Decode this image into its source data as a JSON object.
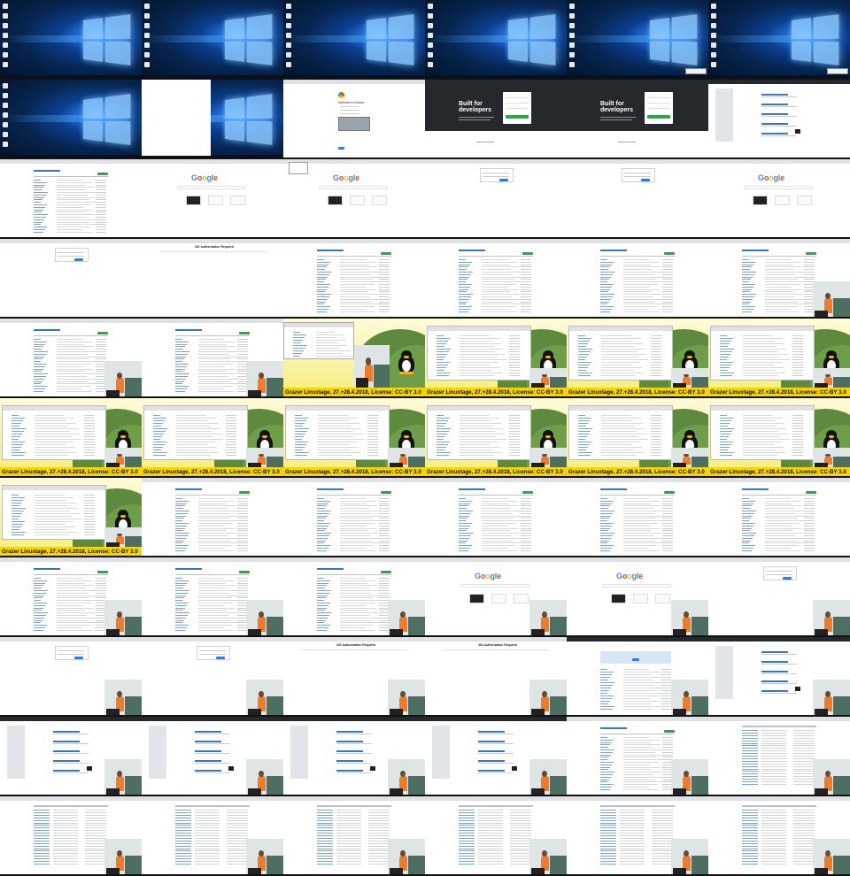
{
  "slide_caption": "Grazer Linuxtage, 27.+28.4.2018, License: CC-BY 3.0",
  "google_logo": {
    "letters": [
      "G",
      "o",
      "o",
      "g",
      "l",
      "e"
    ],
    "colors": [
      "#4285f4",
      "#ea4335",
      "#fbbc05",
      "#4285f4",
      "#34a853",
      "#ea4335"
    ]
  },
  "github_hero": [
    "Built for",
    "developers"
  ],
  "chrome_welcome": "Welcome to Chrome",
  "auth_title": "401 Authorization Required",
  "colors": {
    "github_green": "#2ea44f",
    "link_blue": "#0366d6",
    "slide_yellow": "#f7d400",
    "presenter_shirt": "#f07c28"
  },
  "tiles": [
    "desktop",
    "desktop",
    "desktop",
    "desktop",
    "desktop-dialog",
    "desktop-dialog",
    "desktop",
    "desktop-white",
    "chrome-welcome",
    "github-signup",
    "github-signup",
    "github-repos",
    "file-list",
    "google",
    "google-menu",
    "login",
    "login",
    "google",
    "login",
    "auth-message",
    "file-list-badges",
    "file-list-badges",
    "file-list-badges",
    "file-list-cam",
    "file-list-cam",
    "file-list-cam",
    "slide-browser",
    "slide",
    "slide",
    "slide",
    "slide",
    "slide",
    "slide",
    "slide",
    "slide",
    "slide",
    "slide",
    "file-list",
    "file-list",
    "file-list",
    "file-list",
    "file-list",
    "file-list-cam",
    "file-list-cam",
    "file-list-cam",
    "google-cam",
    "google-cam",
    "login-cam",
    "login-cam",
    "login-cam",
    "auth-cam",
    "auth-cam",
    "map-cam",
    "github-repos-cam",
    "github-repos-cam",
    "github-repos-cam",
    "github-repos-cam",
    "github-repos-cam",
    "file-list-cam",
    "list-table-cam",
    "table-cam",
    "table-cam",
    "table-cam",
    "table-cam",
    "table-cam",
    "table-cam"
  ]
}
